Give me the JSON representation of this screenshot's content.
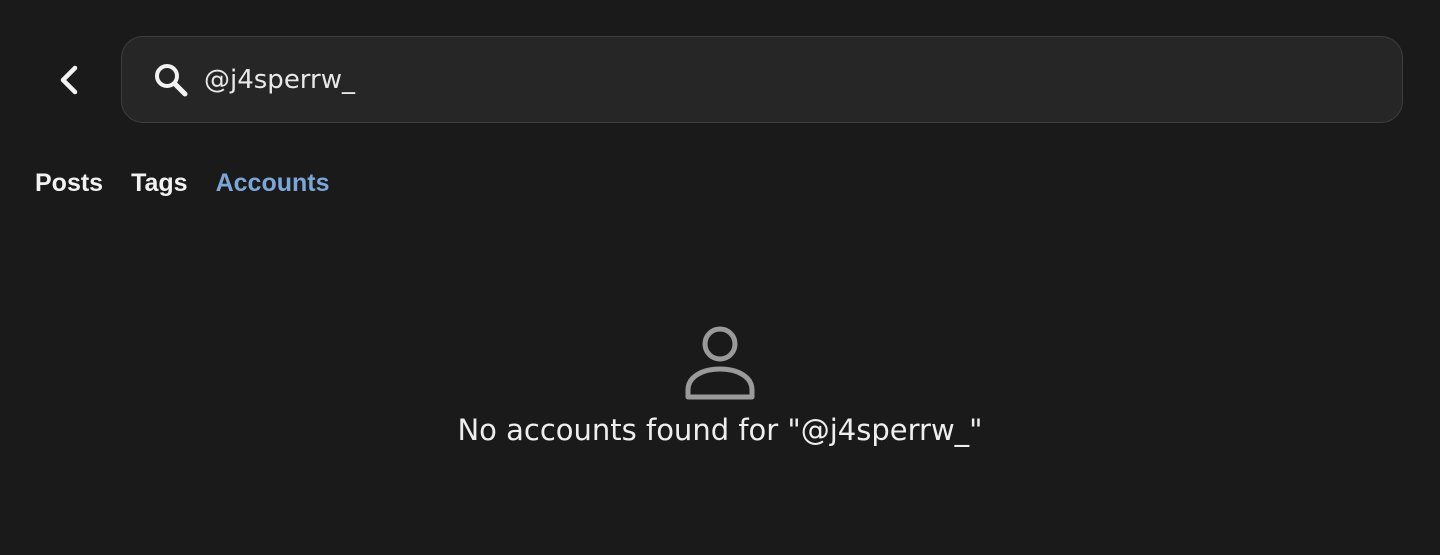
{
  "header": {
    "back_icon": "chevron-left-icon",
    "search": {
      "icon": "search-icon",
      "value": "@j4sperrw_",
      "placeholder": ""
    }
  },
  "tabs": [
    {
      "label": "Posts",
      "active": false
    },
    {
      "label": "Tags",
      "active": false
    },
    {
      "label": "Accounts",
      "active": true
    }
  ],
  "empty_state": {
    "icon": "person-icon",
    "message": "No accounts found for \"@j4sperrw_\""
  },
  "colors": {
    "background": "#1a1a1a",
    "search_background": "#262626",
    "active_tab": "#7aa6d8",
    "text": "#f2f2f2",
    "icon_gray": "#9a9a9a"
  }
}
